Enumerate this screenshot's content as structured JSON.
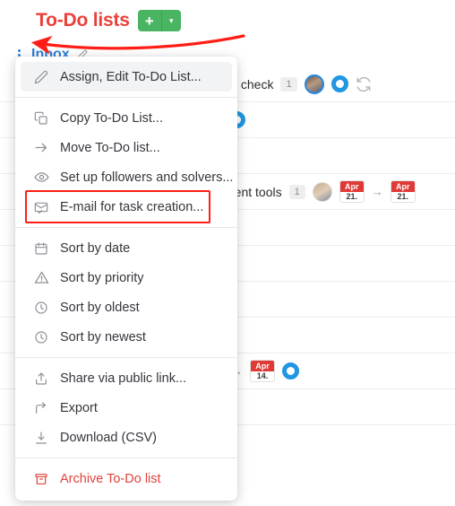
{
  "header": {
    "title": "To-Do lists",
    "add_button": "+",
    "add_caret": "▾"
  },
  "list_header": {
    "kebab_icon": "vertical-dots-icon",
    "name": "Inbox",
    "edit_icon": "pencil-icon"
  },
  "background_rows": [
    {
      "text": "s check",
      "count": "1",
      "has_avatar": true,
      "has_ring": true,
      "has_sync": true
    },
    {
      "text": "",
      "has_ring": true
    },
    {
      "text": "",
      "has_ring": false
    },
    {
      "text": "ment tools",
      "count": "1",
      "has_avatar": true,
      "date_from": {
        "month": "Apr",
        "day": "21."
      },
      "date_to": {
        "month": "Apr",
        "day": "21."
      },
      "arrow": "→"
    },
    {
      "text": ""
    },
    {
      "text": ""
    },
    {
      "text": ""
    },
    {
      "text": ""
    },
    {
      "text": "",
      "arrow": "→",
      "date_to": {
        "month": "Apr",
        "day": "14."
      },
      "has_ring": true
    },
    {
      "text": ""
    }
  ],
  "menu": {
    "groups": [
      {
        "items": [
          {
            "label": "Assign, Edit To-Do List...",
            "icon": "pencil-icon",
            "state": "hovered"
          }
        ]
      },
      {
        "items": [
          {
            "label": "Copy To-Do List...",
            "icon": "copy-icon"
          },
          {
            "label": "Move To-Do list...",
            "icon": "arrow-right-icon"
          },
          {
            "label": "Set up followers and solvers...",
            "icon": "eye-icon"
          },
          {
            "label": "E-mail for task creation...",
            "icon": "envelope-check-icon",
            "state": "highlighted"
          }
        ]
      },
      {
        "items": [
          {
            "label": "Sort by date",
            "icon": "calendar-icon"
          },
          {
            "label": "Sort by priority",
            "icon": "warning-triangle-icon"
          },
          {
            "label": "Sort by oldest",
            "icon": "clock-icon"
          },
          {
            "label": "Sort by newest",
            "icon": "clock-icon"
          }
        ]
      },
      {
        "items": [
          {
            "label": "Share via public link...",
            "icon": "share-upload-icon"
          },
          {
            "label": "Export",
            "icon": "arrow-curve-right-icon"
          },
          {
            "label": "Download (CSV)",
            "icon": "download-icon"
          }
        ]
      },
      {
        "items": [
          {
            "label": "Archive To-Do list",
            "icon": "archive-box-icon",
            "style": "danger"
          }
        ]
      }
    ]
  },
  "annotation": {
    "arrow_color": "#ff1d15",
    "highlight_color": "#ff1d15",
    "target": "vertical-dots-icon"
  },
  "colors": {
    "title_red": "#e8413a",
    "add_green": "#49b461",
    "link_blue": "#2f7fd1",
    "accent_blue": "#2196e3",
    "date_red": "#e03a36",
    "danger_red": "#e0433c"
  }
}
